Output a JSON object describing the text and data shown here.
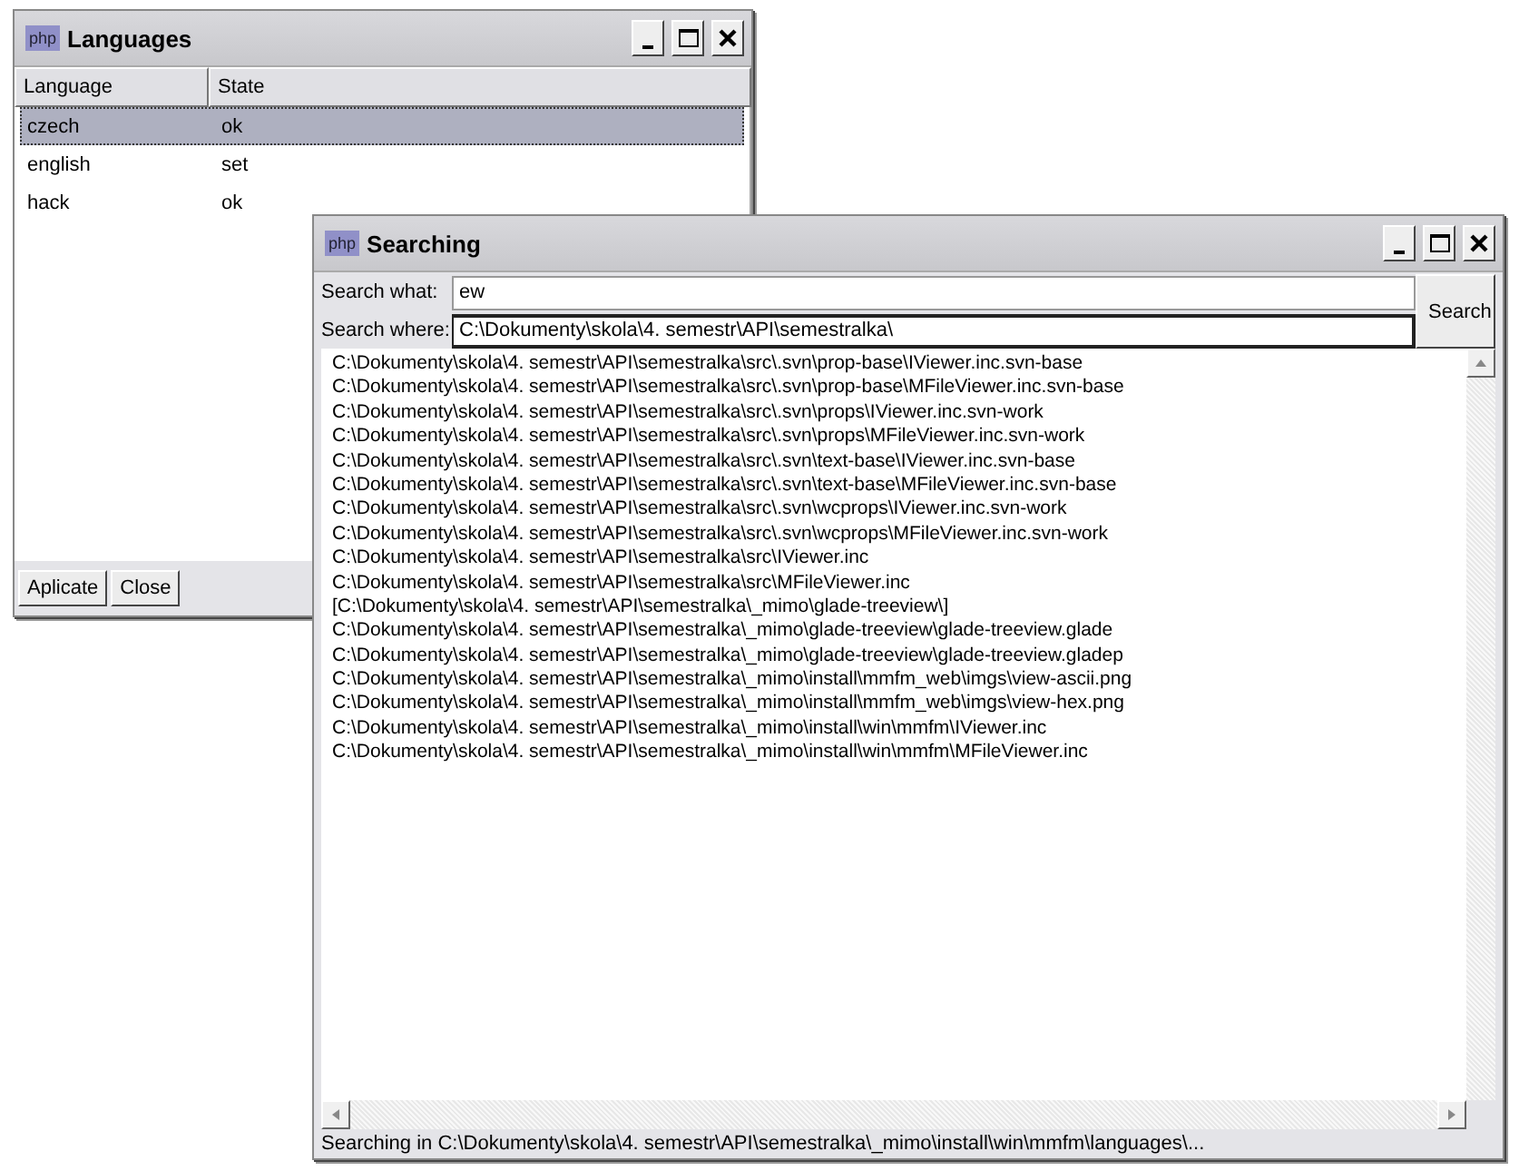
{
  "languages_window": {
    "icon_label": "php",
    "title": "Languages",
    "columns": [
      "Language",
      "State"
    ],
    "rows": [
      {
        "language": "czech",
        "state": "ok",
        "selected": true
      },
      {
        "language": "english",
        "state": "set",
        "selected": false
      },
      {
        "language": "hack",
        "state": "ok",
        "selected": false
      }
    ],
    "buttons": [
      "Aplicate",
      "Close"
    ]
  },
  "search_window": {
    "icon_label": "php",
    "title": "Searching",
    "fields": [
      {
        "label": "Search what:",
        "value": "ew",
        "focused": false
      },
      {
        "label": "Search where:",
        "value": "C:\\Dokumenty\\skola\\4. semestr\\API\\semestralka\\",
        "focused": true
      }
    ],
    "search_button": "Search",
    "results": [
      "C:\\Dokumenty\\skola\\4. semestr\\API\\semestralka\\src\\.svn\\prop-base\\IViewer.inc.svn-base",
      "C:\\Dokumenty\\skola\\4. semestr\\API\\semestralka\\src\\.svn\\prop-base\\MFileViewer.inc.svn-base",
      "C:\\Dokumenty\\skola\\4. semestr\\API\\semestralka\\src\\.svn\\props\\IViewer.inc.svn-work",
      "C:\\Dokumenty\\skola\\4. semestr\\API\\semestralka\\src\\.svn\\props\\MFileViewer.inc.svn-work",
      "C:\\Dokumenty\\skola\\4. semestr\\API\\semestralka\\src\\.svn\\text-base\\IViewer.inc.svn-base",
      "C:\\Dokumenty\\skola\\4. semestr\\API\\semestralka\\src\\.svn\\text-base\\MFileViewer.inc.svn-base",
      "C:\\Dokumenty\\skola\\4. semestr\\API\\semestralka\\src\\.svn\\wcprops\\IViewer.inc.svn-work",
      "C:\\Dokumenty\\skola\\4. semestr\\API\\semestralka\\src\\.svn\\wcprops\\MFileViewer.inc.svn-work",
      "C:\\Dokumenty\\skola\\4. semestr\\API\\semestralka\\src\\IViewer.inc",
      "C:\\Dokumenty\\skola\\4. semestr\\API\\semestralka\\src\\MFileViewer.inc",
      "[C:\\Dokumenty\\skola\\4. semestr\\API\\semestralka\\_mimo\\glade-treeview\\]",
      "C:\\Dokumenty\\skola\\4. semestr\\API\\semestralka\\_mimo\\glade-treeview\\glade-treeview.glade",
      "C:\\Dokumenty\\skola\\4. semestr\\API\\semestralka\\_mimo\\glade-treeview\\glade-treeview.gladep",
      "C:\\Dokumenty\\skola\\4. semestr\\API\\semestralka\\_mimo\\install\\mmfm_web\\imgs\\view-ascii.png",
      "C:\\Dokumenty\\skola\\4. semestr\\API\\semestralka\\_mimo\\install\\mmfm_web\\imgs\\view-hex.png",
      "C:\\Dokumenty\\skola\\4. semestr\\API\\semestralka\\_mimo\\install\\win\\mmfm\\IViewer.inc",
      "C:\\Dokumenty\\skola\\4. semestr\\API\\semestralka\\_mimo\\install\\win\\mmfm\\MFileViewer.inc"
    ],
    "status_bar": "Searching in C:\\Dokumenty\\skola\\4. semestr\\API\\semestralka\\_mimo\\install\\win\\mmfm\\languages\\..."
  }
}
